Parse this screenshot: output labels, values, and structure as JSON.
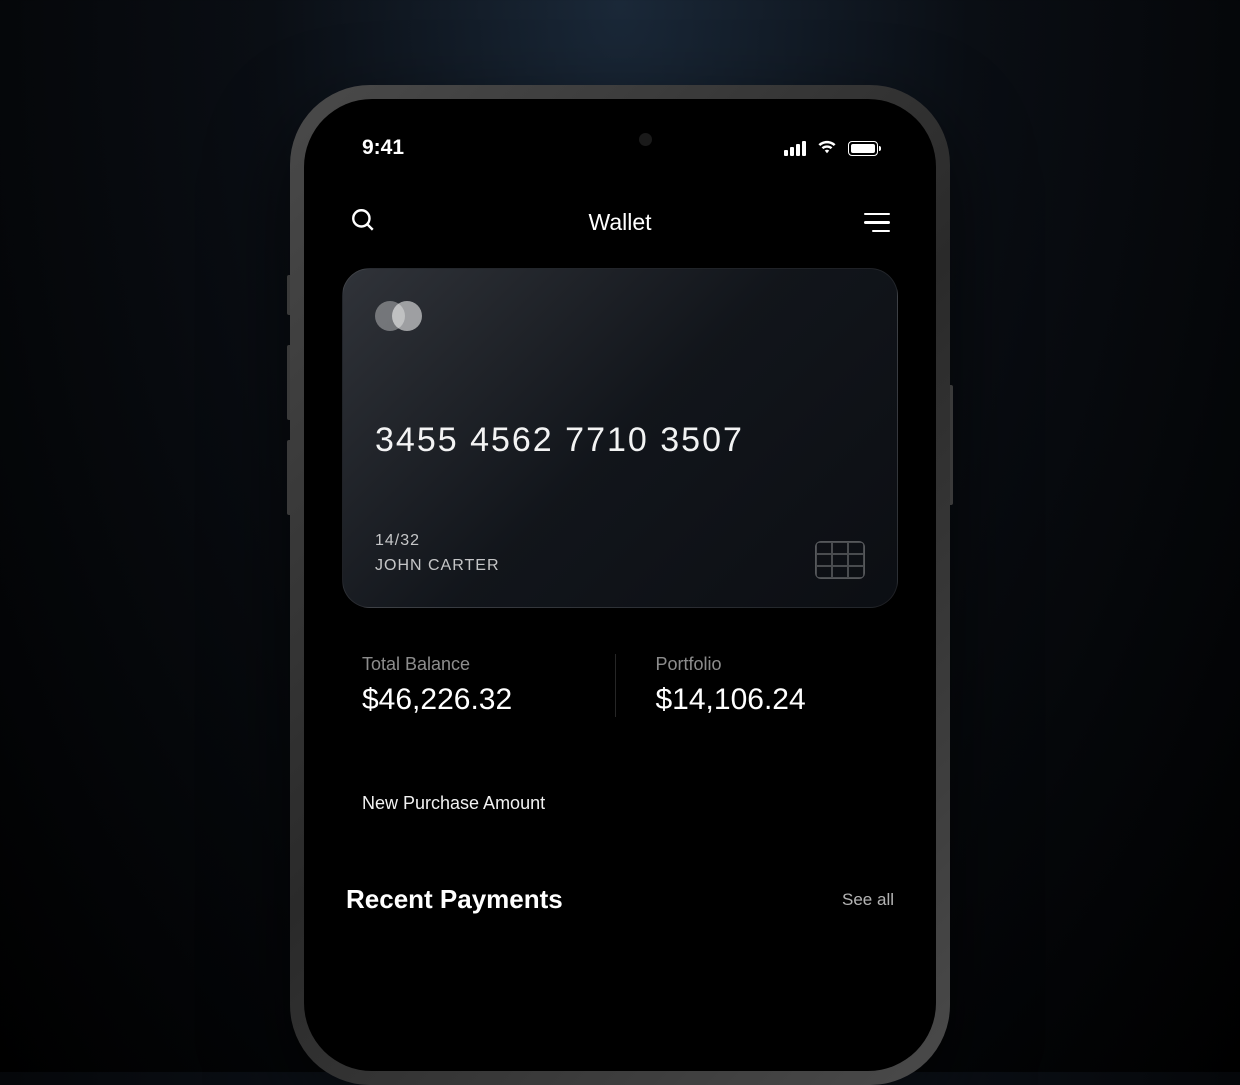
{
  "statusBar": {
    "time": "9:41"
  },
  "header": {
    "title": "Wallet"
  },
  "card": {
    "number": "3455 4562 7710 3507",
    "expiry": "14/32",
    "holder": "JOHN CARTER"
  },
  "balances": {
    "total": {
      "label": "Total Balance",
      "value": "$46,226.32"
    },
    "portfolio": {
      "label": "Portfolio",
      "value": "$14,106.24"
    }
  },
  "purchase": {
    "label": "New Purchase Amount"
  },
  "recent": {
    "title": "Recent Payments",
    "seeAll": "See all"
  }
}
